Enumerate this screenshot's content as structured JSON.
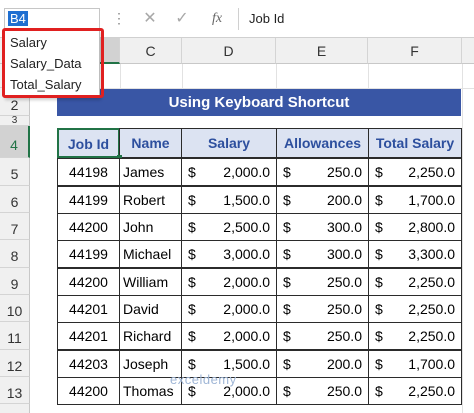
{
  "name_box": {
    "value": "B4"
  },
  "formula_bar": {
    "dots": "⋮",
    "cancel_glyph": "✕",
    "enter_glyph": "✓",
    "fx_label": "fx",
    "content": "Job Id"
  },
  "name_dropdown": {
    "items": [
      "Salary",
      "Salary_Data",
      "Total_Salary"
    ]
  },
  "columns": [
    "C",
    "D",
    "E",
    "F"
  ],
  "rows": [
    "2",
    "3",
    "4",
    "5",
    "6",
    "7",
    "8",
    "9",
    "10",
    "11",
    "12",
    "13"
  ],
  "selected_cell": "B4",
  "title": "Using Keyboard Shortcut",
  "table": {
    "headers": [
      "Job Id",
      "Name",
      "Salary",
      "Allowances",
      "Total Salary"
    ],
    "currency_symbol": "$",
    "rows": [
      [
        "44198",
        "James",
        "2,000.0",
        "250.0",
        "2,250.0"
      ],
      [
        "44199",
        "Robert",
        "1,500.0",
        "200.0",
        "1,700.0"
      ],
      [
        "44200",
        "John",
        "2,500.0",
        "300.0",
        "2,800.0"
      ],
      [
        "44199",
        "Michael",
        "3,000.0",
        "300.0",
        "3,300.0"
      ],
      [
        "44200",
        "William",
        "2,000.0",
        "250.0",
        "2,250.0"
      ],
      [
        "44201",
        "David",
        "2,000.0",
        "250.0",
        "2,250.0"
      ],
      [
        "44201",
        "Richard",
        "2,000.0",
        "250.0",
        "2,250.0"
      ],
      [
        "44203",
        "Joseph",
        "1,500.0",
        "200.0",
        "1,700.0"
      ],
      [
        "44200",
        "Thomas",
        "2,000.0",
        "250.0",
        "2,250.0"
      ]
    ]
  },
  "watermark": "exceldemy",
  "colors": {
    "title_bg": "#3956a5",
    "header_bg": "#dce3f2",
    "header_text": "#2d4f9e",
    "selection": "#217346",
    "highlight_box": "#e02020"
  }
}
